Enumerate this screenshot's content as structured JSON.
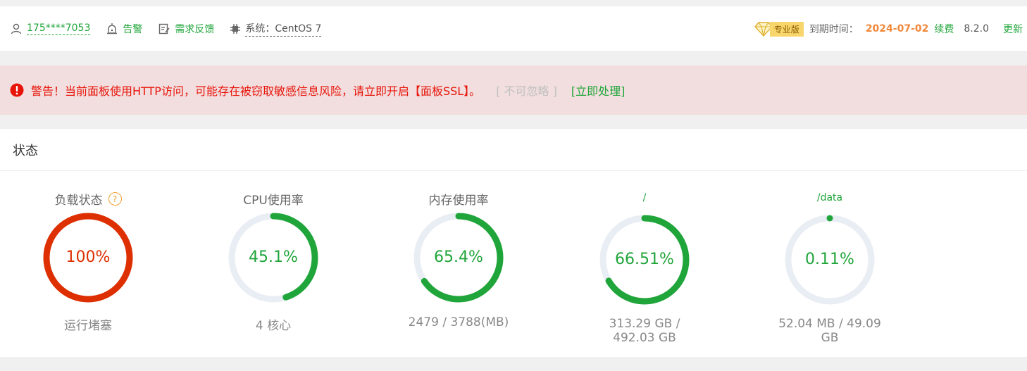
{
  "topbar": {
    "user": "175****7053",
    "alarm": "告警",
    "feedback": "需求反馈",
    "system": "系统：CentOS 7",
    "edition": "专业版",
    "expire_label": "到期时间：",
    "expire_date": "2024-07-02",
    "renew": "续费",
    "version": "8.2.0",
    "update": "更新"
  },
  "alert": {
    "message": "警告！当前面板使用HTTP访问，可能存在被窃取敏感信息风险，请立即开启【面板SSL】。",
    "ignore": "[ 不可忽略 ]",
    "action": "[立即处理]"
  },
  "status": {
    "title": "状态",
    "gauges": [
      {
        "title": "负载状态",
        "value": "100%",
        "percent": 100,
        "sub": "运行堵塞",
        "color": "#dd2f00"
      },
      {
        "title": "CPU使用率",
        "value": "45.1%",
        "percent": 45.1,
        "sub": "4 核心",
        "color": "#20a53a"
      },
      {
        "title": "内存使用率",
        "value": "65.4%",
        "percent": 65.4,
        "sub": "2479 / 3788(MB)",
        "color": "#20a53a"
      },
      {
        "title": "/",
        "value": "66.51%",
        "percent": 66.51,
        "sub": "313.29 GB / 492.03 GB",
        "color": "#20a53a"
      },
      {
        "title": "/data",
        "value": "0.11%",
        "percent": 0.11,
        "sub": "52.04 MB / 49.09 GB",
        "color": "#20a53a"
      }
    ]
  },
  "colors": {
    "accent": "#20a53a",
    "danger": "#dd2f00",
    "warning": "#f0883a",
    "track": "#e9edf4"
  }
}
